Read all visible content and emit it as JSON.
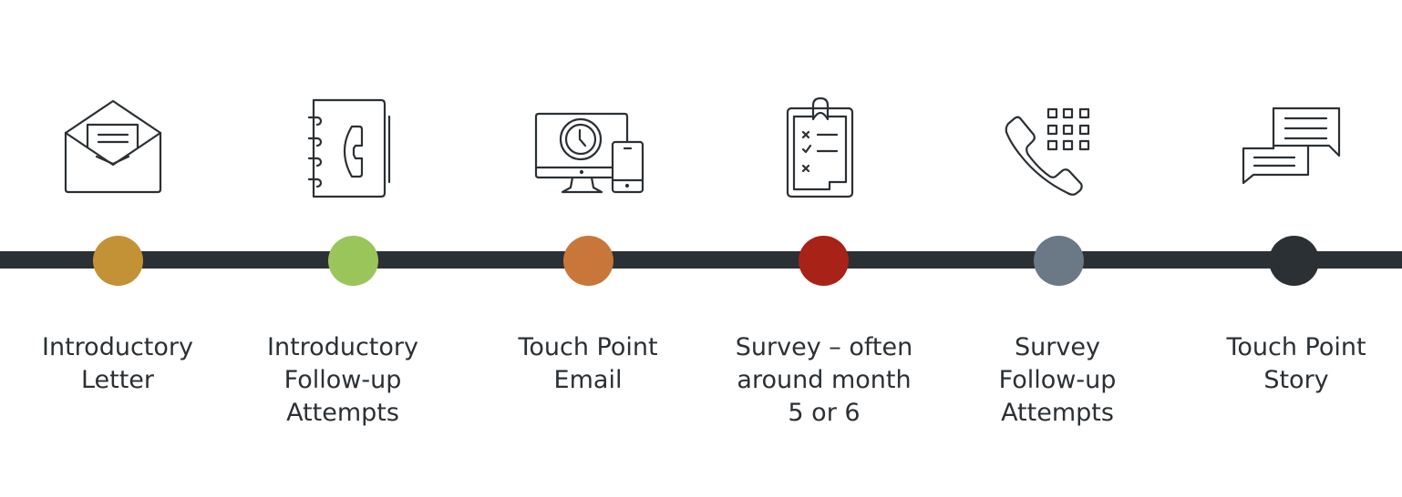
{
  "colors": {
    "line": "#2b3034",
    "icon_stroke": "#2b3034",
    "text": "#2b3034"
  },
  "steps": [
    {
      "label": "Introductory\nLetter",
      "icon": "open-envelope-icon",
      "color": "#c49236"
    },
    {
      "label": "Introductory\nFollow-up\nAttempts",
      "icon": "phone-book-icon",
      "color": "#9ac55a"
    },
    {
      "label": "Touch Point\nEmail",
      "icon": "desktop-mobile-clock-icon",
      "color": "#c8763a"
    },
    {
      "label": "Survey – often\naround month\n5 or 6",
      "icon": "clipboard-checklist-icon",
      "color": "#a82217"
    },
    {
      "label": "Survey\nFollow-up\nAttempts",
      "icon": "phone-keypad-icon",
      "color": "#6b7886"
    },
    {
      "label": "Touch Point\nStory",
      "icon": "chat-bubbles-icon",
      "color": "#2b3034"
    }
  ]
}
